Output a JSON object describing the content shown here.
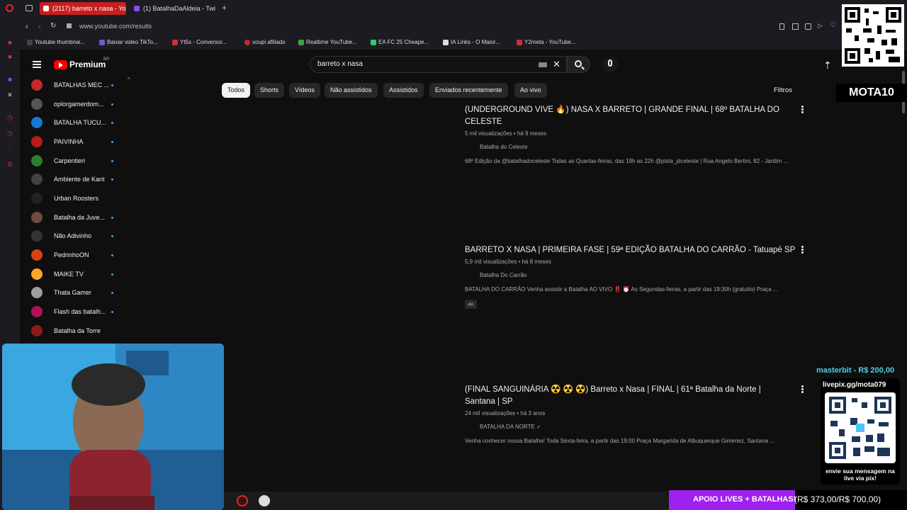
{
  "browser": {
    "tabs": [
      {
        "label": "(2117) barreto x nasa - You",
        "active": true
      },
      {
        "label": "(1) BatalhaDaAldeia - Twitc",
        "active": false
      }
    ],
    "new_tab": "+",
    "url": "www.youtube.com/results",
    "bookmarks": [
      "Youtube thumbnai...",
      "Baixar video TikTo...",
      "Yt5s - Conversor...",
      "xoupi afiliado",
      "Realtime YouTube...",
      "EA FC 25 Cheape...",
      "IA Links - O Maior...",
      "Y2meta - YouTube..."
    ]
  },
  "youtube": {
    "logo_text": "Premium",
    "logo_region": "BR",
    "search_query": "barreto x nasa",
    "chips": [
      "Todos",
      "Shorts",
      "Vídeos",
      "Não assistidos",
      "Assistidos",
      "Enviados recentemente",
      "Ao vivo"
    ],
    "filters_label": "Filtros",
    "subscriptions": [
      {
        "name": "BATALHAS MEC ...",
        "color": "#c62828"
      },
      {
        "name": "oplorgamerdom...",
        "color": "#555555"
      },
      {
        "name": "BATALHA TUCU...",
        "color": "#1976d2"
      },
      {
        "name": "PAIVINHA",
        "color": "#b71c1c"
      },
      {
        "name": "Carpentieri",
        "color": "#2e7d32"
      },
      {
        "name": "Ambiente de Kant",
        "color": "#424242"
      },
      {
        "name": "Urban Roosters",
        "color": "#222222"
      },
      {
        "name": "Batalha da Juve...",
        "color": "#6d4c41"
      },
      {
        "name": "Não Adivinho",
        "color": "#333333"
      },
      {
        "name": "PedrinhoON",
        "color": "#d84315"
      },
      {
        "name": "MAIKE TV",
        "color": "#f9a825"
      },
      {
        "name": "Thata Gamer",
        "color": "#9e9e9e"
      },
      {
        "name": "Flash das batalh...",
        "color": "#ad1457"
      },
      {
        "name": "Batalha da Torre",
        "color": "#8e1b1b"
      }
    ],
    "results": [
      {
        "title": "(UNDERGROUND VIVE 🔥) NASA X BARRETO | GRANDE FINAL | 68º BATALHA DO CELESTE",
        "meta": "5 mil visualizações • há 9 meses",
        "channel": "Batalha do Celeste",
        "description": "68ª Edição da @batalhadoceleste Todas as Quartas-feiras, das 19h as 22h @pista_jdceleste | Rua Angelo Bertini, 82 - Jardim ...",
        "badge": ""
      },
      {
        "title": "BARRETO X NASA | PRIMEIRA FASE | 59ª EDIÇÃO BATALHA DO CARRÃO - Tatuapé SP",
        "meta": "5,9 mil visualizações • há 8 meses",
        "channel": "Batalha Do Carrão",
        "description": "BATALHA DO CARRÃO Venha assistir a Batalha AO VIVO ‼️ ⏰ As Segundas-feiras, a partir das 19:30h (gratuito) Praça ...",
        "badge": "4K"
      },
      {
        "title": "(FINAL SANGUINÁRIA ☢️ ☢️ ☢️) Barreto x Nasa | FINAL | 61ª Batalha da Norte | Santana | SP",
        "meta": "24 mil visualizações • há 3 anos",
        "channel": "BATALHA DA NORTE ✓",
        "description": "Venha conhecer nossa Batalha! Toda Sexta-feira, a partir das 19:00 Praça Margarida de Albuquerque Gimenez, Santana ...",
        "badge": ""
      }
    ]
  },
  "stream_overlay": {
    "streamer_tag": "MOTA10",
    "donation": "masterbit - R$ 200,00",
    "livepix_url": "livepix.gg/mota079",
    "livepix_caption": "envie sua mensagem na live via pix!",
    "goal_label": "APOIO LIVES + BATALHAS!",
    "goal_progress": "R$ 373,00/R$ 700,00",
    "goal_fraction": 0.53
  }
}
